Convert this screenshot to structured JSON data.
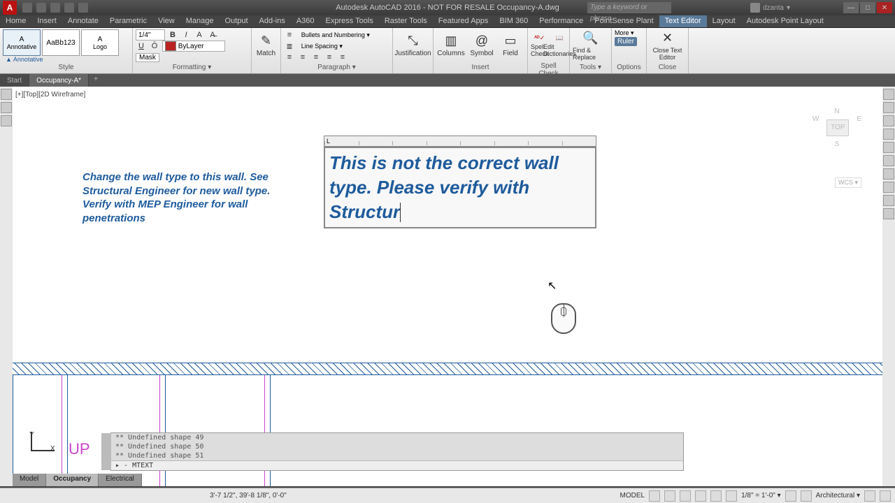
{
  "titlebar": {
    "title": "Autodesk AutoCAD 2016 - NOT FOR RESALE    Occupancy-A.dwg",
    "search_placeholder": "Type a keyword or phrase",
    "username": "dzanta"
  },
  "ribbon_tabs": [
    "Home",
    "Insert",
    "Annotate",
    "Parametric",
    "View",
    "Manage",
    "Output",
    "Add-ins",
    "A360",
    "Express Tools",
    "Raster Tools",
    "Featured Apps",
    "BIM 360",
    "Performance",
    "PointSense Plant",
    "Text Editor",
    "Layout",
    "Autodesk Point Layout"
  ],
  "ribbon_active_tab": "Text Editor",
  "style": {
    "label": "Style",
    "samples": [
      {
        "text": "A",
        "sub": "Annotative"
      },
      {
        "text": "AaBb123",
        "sub": ""
      },
      {
        "text": "A",
        "sub": "Logo"
      }
    ],
    "current_style": "Annotative"
  },
  "formatting": {
    "label": "Formatting ▾",
    "height": "1/4\"",
    "mask": "Mask",
    "layer": "ByLayer"
  },
  "match": {
    "label": "Match"
  },
  "paragraph": {
    "label": "Paragraph ▾",
    "justification": "Justification",
    "bullets": "Bullets and Numbering ▾",
    "line_spacing": "Line Spacing ▾"
  },
  "insert": {
    "label": "Insert",
    "columns": "Columns",
    "symbol": "Symbol",
    "field": "Field"
  },
  "spell_check": {
    "label": "Spell Check",
    "spell": "Spell Check",
    "edit_dict": "Edit Dictionaries"
  },
  "tools": {
    "label": "Tools ▾",
    "find": "Find & Replace"
  },
  "options": {
    "label": "Options",
    "more": "More ▾",
    "ruler": "Ruler"
  },
  "close_panel": {
    "label": "Close",
    "btn": "Close Text Editor"
  },
  "doc_tabs": {
    "start": "Start",
    "file": "Occupancy-A*"
  },
  "viewport_label": "[+][Top][2D Wireframe]",
  "navcube": {
    "n": "N",
    "s": "S",
    "e": "E",
    "w": "W",
    "top": "TOP",
    "wcs": "WCS ▾"
  },
  "static_note": "Change the wall type to this wall.  See Structural Engineer for new wall type. Verify with MEP Engineer for wall penetrations",
  "mtext_content": "This is not the correct wall type.  Please verify with Structur",
  "ucs": {
    "x": "X",
    "y": "Y"
  },
  "up": "UP",
  "command_lines": [
    "** Undefined shape 49",
    "** Undefined shape 50",
    "** Undefined shape 51"
  ],
  "command_current": "▸ - MTEXT",
  "layout_tabs": [
    "Model",
    "Occupancy",
    "Electrical"
  ],
  "layout_active": "Occupancy",
  "status": {
    "coords": "3'-7 1/2\", 39'-8 1/8\", 0'-0\"",
    "space": "MODEL",
    "scale": "1/8\" = 1'-0\" ▾",
    "units": "Architectural ▾"
  }
}
